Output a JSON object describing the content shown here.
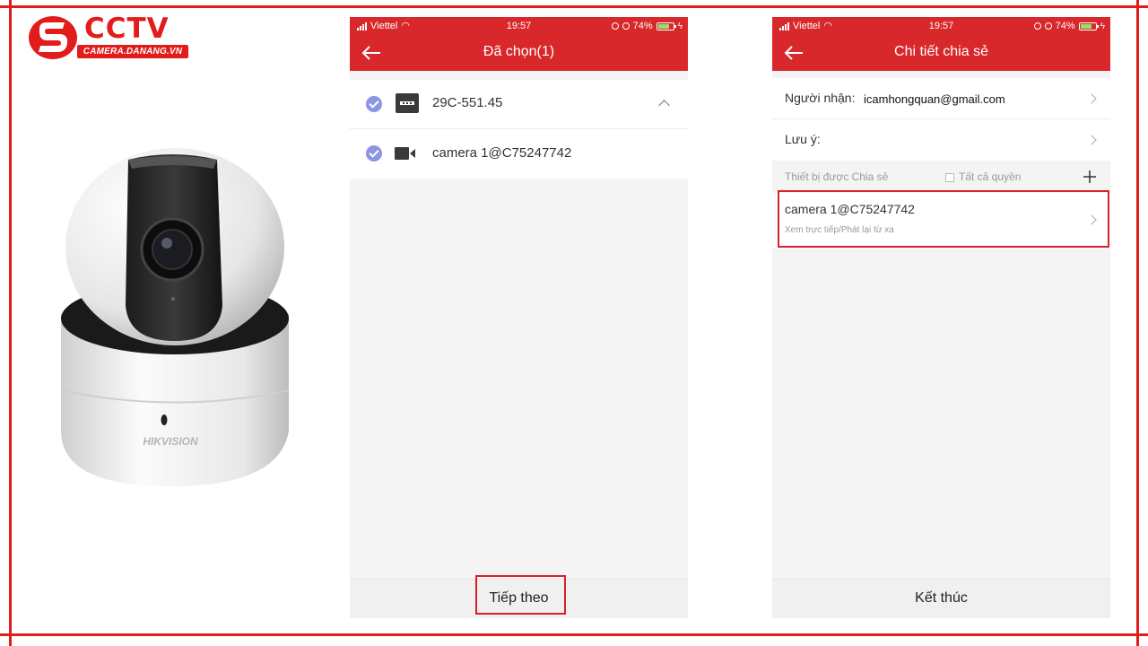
{
  "logo": {
    "text": "CCTV",
    "subtitle": "CAMERA.DANANG.VN"
  },
  "camera_image": {
    "brand": "HIKVISION"
  },
  "screen_select": {
    "status": {
      "carrier": "Viettel",
      "time": "19:57",
      "battery": "74%"
    },
    "title": "Đã chọn(1)",
    "items": [
      {
        "label": "29C-551.45",
        "type": "nvr",
        "checked": true,
        "expanded": true
      },
      {
        "label": "camera 1@C75247742",
        "type": "camera",
        "checked": true
      }
    ],
    "next_label": "Tiếp theo"
  },
  "screen_share": {
    "status": {
      "carrier": "Viettel",
      "time": "19:57",
      "battery": "74%"
    },
    "title": "Chi tiết chia sẻ",
    "recipient_label": "Người nhận:",
    "recipient_value": "icamhongquan@gmail.com",
    "note_label": "Lưu ý:",
    "shared_devices_label": "Thiết bị được Chia sẻ",
    "all_permissions_label": "Tất cả quyền",
    "device": {
      "name": "camera 1@C75247742",
      "permissions": "Xem trực tiếp/Phát lại từ xa"
    },
    "finish_label": "Kết thúc"
  },
  "colors": {
    "frame": "#e21b1b",
    "appbar": "#d8282b",
    "check": "#8c96e4"
  }
}
